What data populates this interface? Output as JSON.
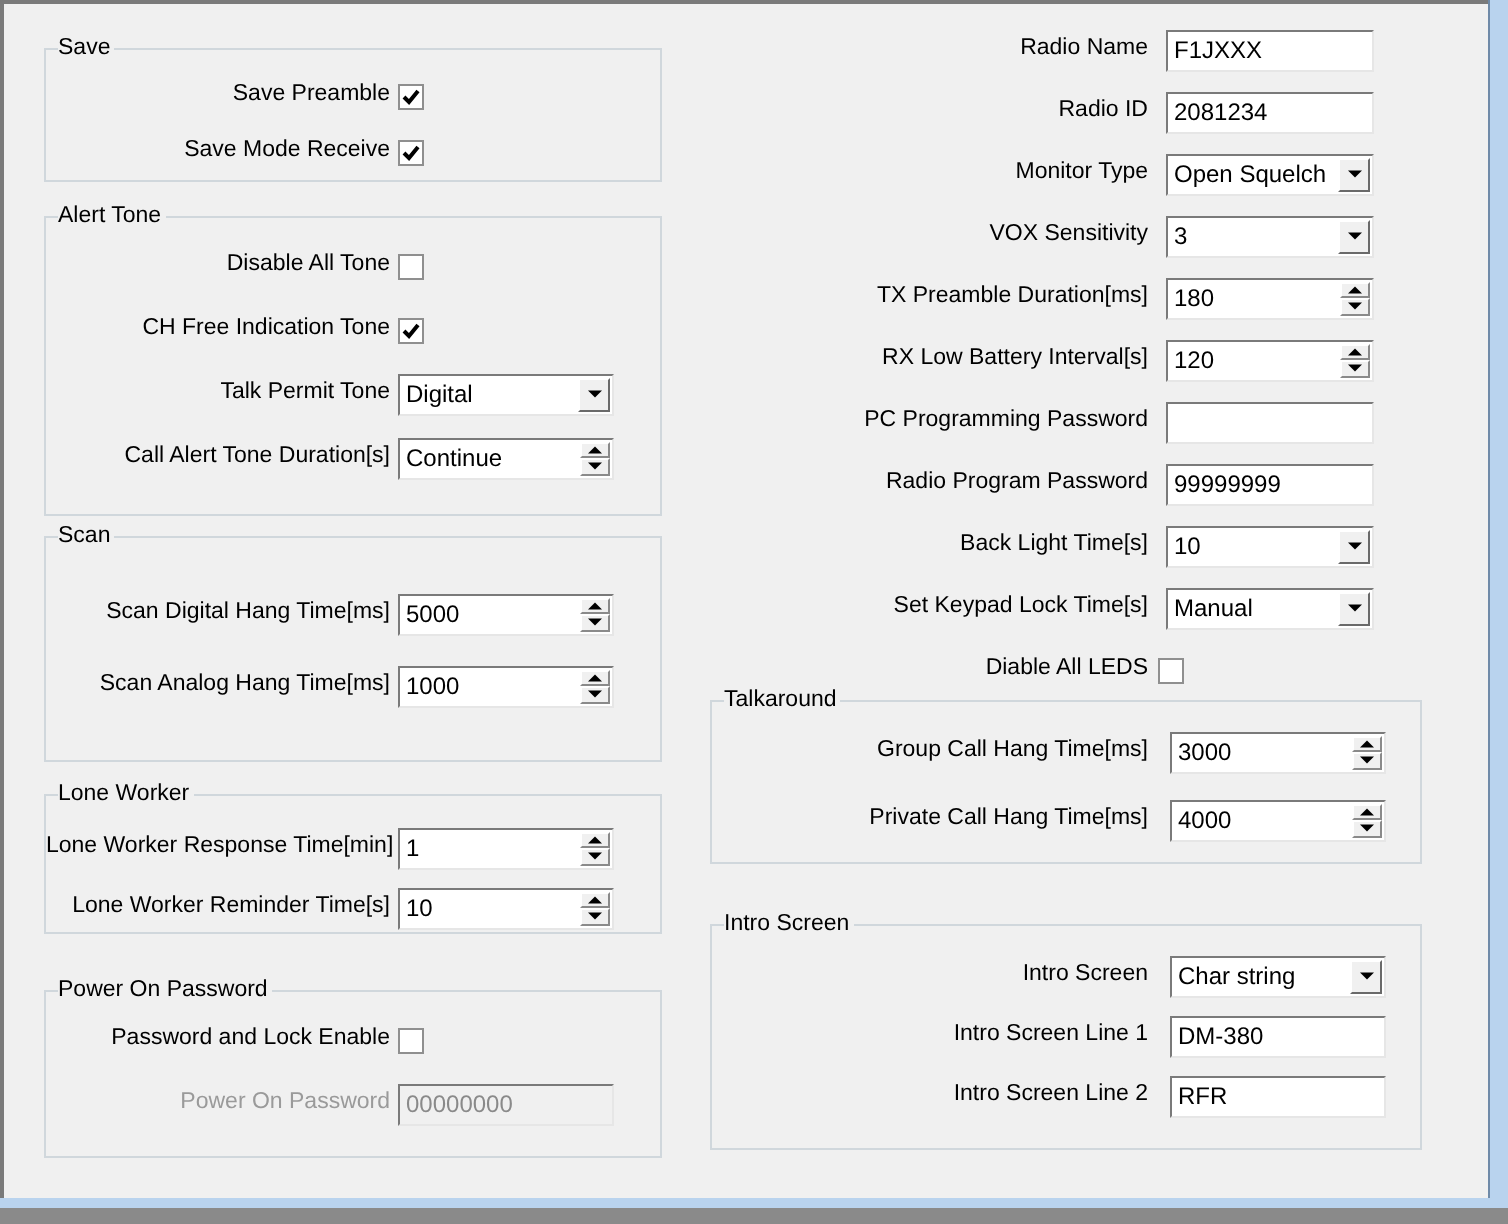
{
  "left_groups": [
    {
      "title": "Save",
      "rows": [
        {
          "kind": "checkbox",
          "label": "Save Preamble",
          "checked": true
        },
        {
          "kind": "checkbox",
          "label": "Save Mode Receive",
          "checked": true
        }
      ]
    },
    {
      "title": "Alert Tone",
      "rows": [
        {
          "kind": "checkbox",
          "label": "Disable All Tone",
          "checked": false
        },
        {
          "kind": "checkbox",
          "label": "CH Free Indication Tone",
          "checked": true
        },
        {
          "kind": "combo",
          "label": "Talk Permit Tone",
          "value": "Digital"
        },
        {
          "kind": "spin",
          "label": "Call Alert Tone Duration[s]",
          "value": "Continue"
        }
      ]
    },
    {
      "title": "Scan",
      "rows": [
        {
          "kind": "spin",
          "label": "Scan Digital Hang Time[ms]",
          "value": "5000"
        },
        {
          "kind": "spin",
          "label": "Scan Analog Hang Time[ms]",
          "value": "1000"
        }
      ]
    },
    {
      "title": "Lone Worker",
      "rows": [
        {
          "kind": "spin",
          "label": "Lone Worker Response Time[min]",
          "value": "1"
        },
        {
          "kind": "spin",
          "label": "Lone Worker Reminder Time[s]",
          "value": "10"
        }
      ]
    },
    {
      "title": "Power On Password",
      "rows": [
        {
          "kind": "checkbox",
          "label": "Password and Lock Enable",
          "checked": false,
          "disabled": false
        },
        {
          "kind": "text",
          "label": "Power On Password",
          "value": "00000000",
          "disabled": true
        }
      ]
    }
  ],
  "right_fields": [
    {
      "kind": "text",
      "label": "Radio Name",
      "value": "F1JXXX"
    },
    {
      "kind": "text",
      "label": "Radio ID",
      "value": "2081234"
    },
    {
      "kind": "combo",
      "label": "Monitor Type",
      "value": "Open Squelch"
    },
    {
      "kind": "combo",
      "label": "VOX Sensitivity",
      "value": "3"
    },
    {
      "kind": "spin",
      "label": "TX Preamble Duration[ms]",
      "value": "180"
    },
    {
      "kind": "spin",
      "label": "RX Low Battery Interval[s]",
      "value": "120"
    },
    {
      "kind": "text",
      "label": "PC Programming Password"
    },
    {
      "kind": "text",
      "label": "Radio Program Password",
      "value": "99999999"
    },
    {
      "kind": "combo",
      "label": "Back Light Time[s]",
      "value": "10"
    },
    {
      "kind": "combo",
      "label": "Set Keypad Lock Time[s]",
      "value": "Manual"
    },
    {
      "kind": "checkbox",
      "label": "Diable All LEDS",
      "checked": false
    }
  ],
  "right_groups": [
    {
      "title": "Talkaround",
      "rows": [
        {
          "kind": "spin",
          "label": "Group Call Hang Time[ms]",
          "value": "3000"
        },
        {
          "kind": "spin",
          "label": "Private Call Hang Time[ms]",
          "value": "4000"
        }
      ]
    },
    {
      "title": "Intro Screen",
      "rows": [
        {
          "kind": "combo",
          "label": "Intro Screen",
          "value": "Char string"
        },
        {
          "kind": "text",
          "label": "Intro Screen Line 1",
          "value": "DM-380"
        },
        {
          "kind": "text",
          "label": "Intro Screen Line 2",
          "value": "RFR"
        }
      ]
    }
  ]
}
